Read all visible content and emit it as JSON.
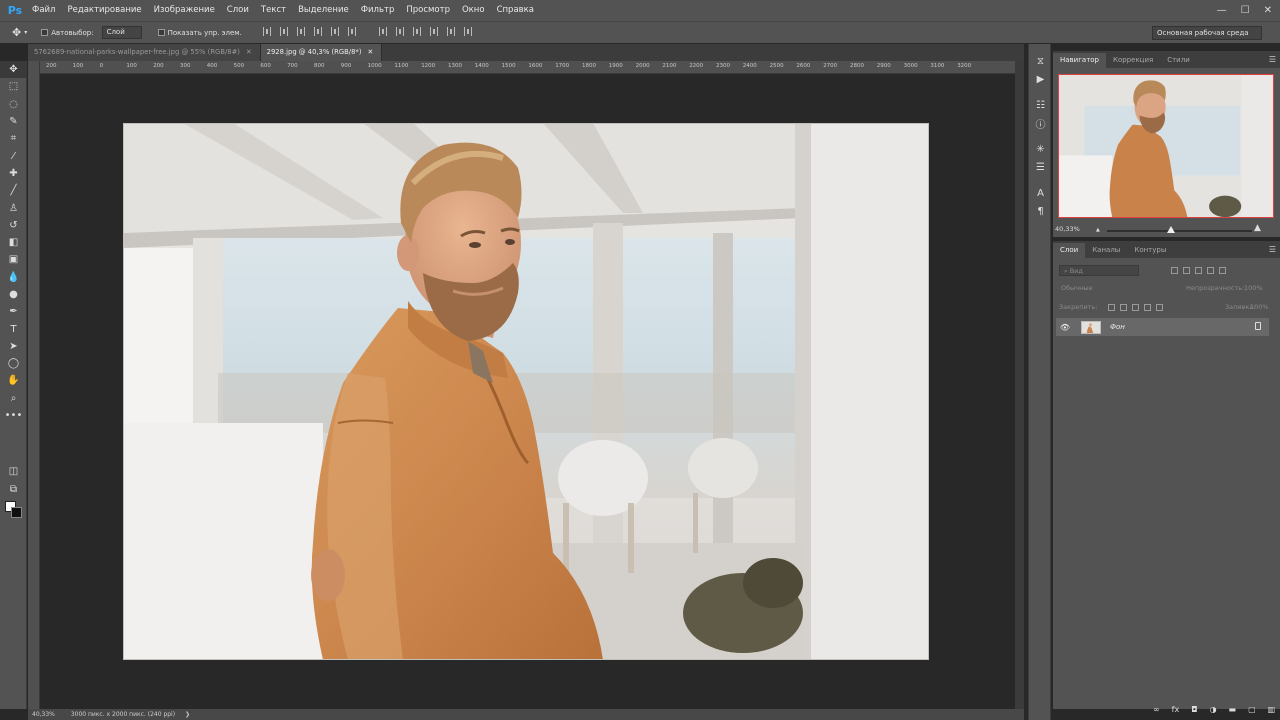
{
  "app": {
    "logo": "Ps"
  },
  "menu": [
    "Файл",
    "Редактирование",
    "Изображение",
    "Слои",
    "Текст",
    "Выделение",
    "Фильтр",
    "Просмотр",
    "Окно",
    "Справка"
  ],
  "window_controls": {
    "minimize": "—",
    "maximize": "☐",
    "close": "✕"
  },
  "options": {
    "autoselect_label": "Автовыбор:",
    "autoselect_value": "Слой",
    "show_transform_label": "Показать упр. элем.",
    "workspace": "Основная рабочая среда"
  },
  "doc_tabs": [
    {
      "title": "5762689-national-parks-wallpaper-free.jpg @ 55% (RGB/8#)",
      "close": "✕"
    },
    {
      "title": "2928.jpg @ 40,3% (RGB/8*)",
      "close": "✕"
    }
  ],
  "ruler_ticks": [
    "200",
    "100",
    "0",
    "100",
    "200",
    "300",
    "400",
    "500",
    "600",
    "700",
    "800",
    "900",
    "1000",
    "1100",
    "1200",
    "1300",
    "1400",
    "1500",
    "1600",
    "1700",
    "1800",
    "1900",
    "2000",
    "2100",
    "2200",
    "2300",
    "2400",
    "2500",
    "2600",
    "2700",
    "2800",
    "2900",
    "3000",
    "3100",
    "3200"
  ],
  "status": {
    "zoom": "40,33%",
    "doc_info": "3000 пикс. x 2000 пикс. (240 ppi)",
    "arrow": "❯"
  },
  "navigator_panel": {
    "tabs": [
      "Навигатор",
      "Коррекция",
      "Стили"
    ],
    "zoom": "40,33%",
    "zoom_out": "▲",
    "zoom_in": "▲"
  },
  "layers_panel": {
    "tabs": [
      "Слои",
      "Каналы",
      "Контуры"
    ],
    "search_placeholder": "Вид",
    "blend_mode": "Обычные",
    "opacity_label": "Непрозрачность:",
    "opacity_value": "100%",
    "lock_label": "Закрепить:",
    "fill_label": "Заливка:",
    "fill_value": "100%",
    "layers": [
      {
        "name": "Фон",
        "visible": true,
        "locked": true
      }
    ],
    "footer_icons": [
      "link-icon",
      "fx-icon",
      "mask-icon",
      "adjustment-icon",
      "folder-icon",
      "new-layer-icon",
      "trash-icon"
    ],
    "footer_glyphs": [
      "∞",
      "fx",
      "◘",
      "◑",
      "▬",
      "▢",
      "▥"
    ]
  }
}
